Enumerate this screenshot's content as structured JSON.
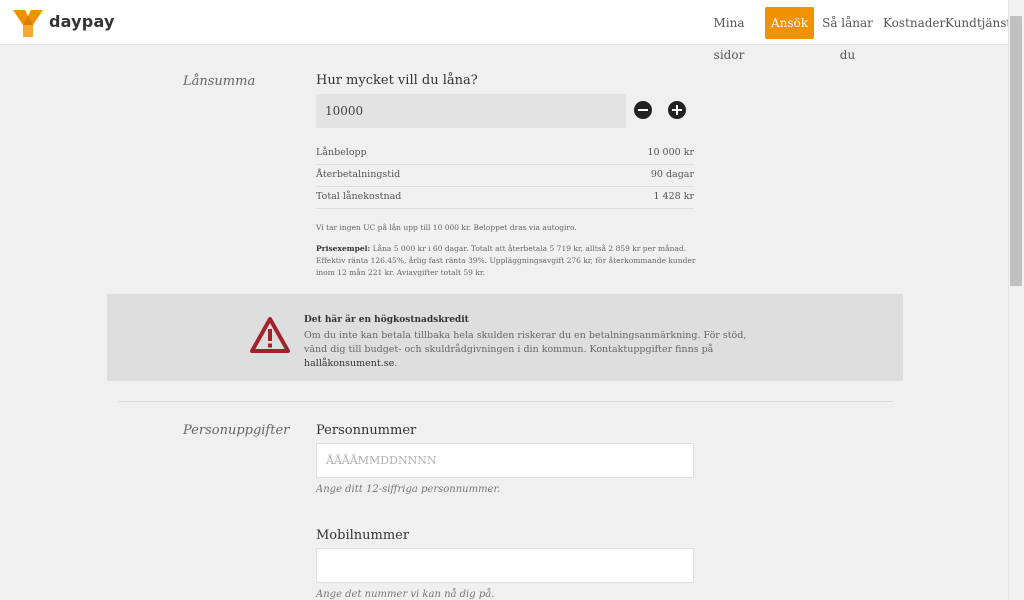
{
  "brand": {
    "name": "daypay",
    "accent": "#f39200"
  },
  "nav": {
    "items": [
      {
        "label": "Mina sidor"
      },
      {
        "label": "Ansök"
      },
      {
        "label": "Så lånar du"
      },
      {
        "label": "Kostnader"
      },
      {
        "label": "Kundtjänst"
      }
    ],
    "active": "Ansök"
  },
  "loan": {
    "section_label": "Lånsumma",
    "question": "Hur mycket vill du låna?",
    "amount_value": "10000",
    "decrease_icon": "minus-circle-icon",
    "increase_icon": "plus-circle-icon",
    "summary": [
      {
        "label": "Lånbelopp",
        "value": "10 000 kr"
      },
      {
        "label": "Återbetalningstid",
        "value": "90 dagar"
      },
      {
        "label": "Total lånekostnad",
        "value": "1 428 kr"
      }
    ],
    "note": "Vi tar ingen UC på lån upp till 10 000 kr. Beloppet dras via autogiro.",
    "example_label": "Prisexempel:",
    "example_text": "Låna 5 000 kr i 60 dagar. Totalt att återbetala 5 719 kr, alltså 2 859 kr per månad. Effektiv ränta 126.45%, årlig fast ränta 39%. Uppläggningsavgift 276 kr, för återkommande kunder inom 12 mån 221 kr. Aviavgifter totalt 59 kr."
  },
  "warning": {
    "icon": "warning-triangle-icon",
    "title": "Det här är en högkostnadskredit",
    "text": "Om du inte kan betala tillbaka hela skulden riskerar du en betalningsanmärkning. För stöd, vänd dig till budget- och skuldrådgivningen i din kommun. Kontaktuppgifter finns på",
    "link": "hallåkonsument.se",
    "end": ".",
    "color": "#a3232b"
  },
  "personal": {
    "section_label": "Personuppgifter",
    "ssn_label": "Personnummer",
    "ssn_placeholder": "ÅÅÅÅMMDDNNNN",
    "ssn_help": "Ange ditt 12-siffriga personnummer.",
    "phone_label": "Mobilnummer",
    "phone_placeholder": "",
    "phone_help": "Ange det nummer vi kan nå dig på."
  }
}
